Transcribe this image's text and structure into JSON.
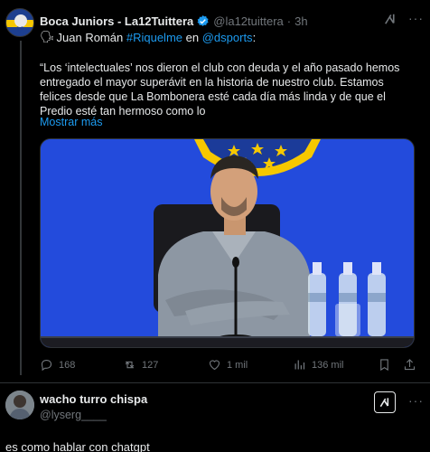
{
  "post": {
    "display_name": "Boca Juniors - La12Tuittera",
    "handle": "@la12tuittera",
    "dot": "·",
    "time": "3h",
    "speaker_emoji": "🗣",
    "intro_name": "Juan Román",
    "hashtag": "#Riquelme",
    "intro_connector": "en",
    "mention": "@dsports",
    "intro_colon": ":",
    "body": "“Los ‘intelectuales’ nos dieron el club con deuda y el año pasado hemos entregado el mayor superávit en la historia de nuestro club. Estamos felices desde que La Bombonera esté cada día más linda y de que el Predio esté tan hermoso como lo",
    "show_more": "Mostrar más",
    "more_glyph": "···"
  },
  "stats": {
    "replies": "168",
    "retweets": "127",
    "likes": "1 mil",
    "views": "136 mil"
  },
  "reply": {
    "display_name": "wacho turro chispa",
    "handle": "@lyserg____",
    "text": "es como hablar con chatgpt",
    "more_glyph": "···"
  },
  "icons": {
    "verified": "verified-badge-icon",
    "grok": "grok-icon",
    "reply": "reply-icon",
    "retweet": "retweet-icon",
    "like": "heart-icon",
    "views": "views-icon",
    "bookmark": "bookmark-icon"
  },
  "colors": {
    "background": "#000000",
    "text": "#e7e9ea",
    "muted": "#71767b",
    "link": "#1d9bf0",
    "media_blue": "#1f46d8",
    "boca_yellow": "#f6c800"
  }
}
